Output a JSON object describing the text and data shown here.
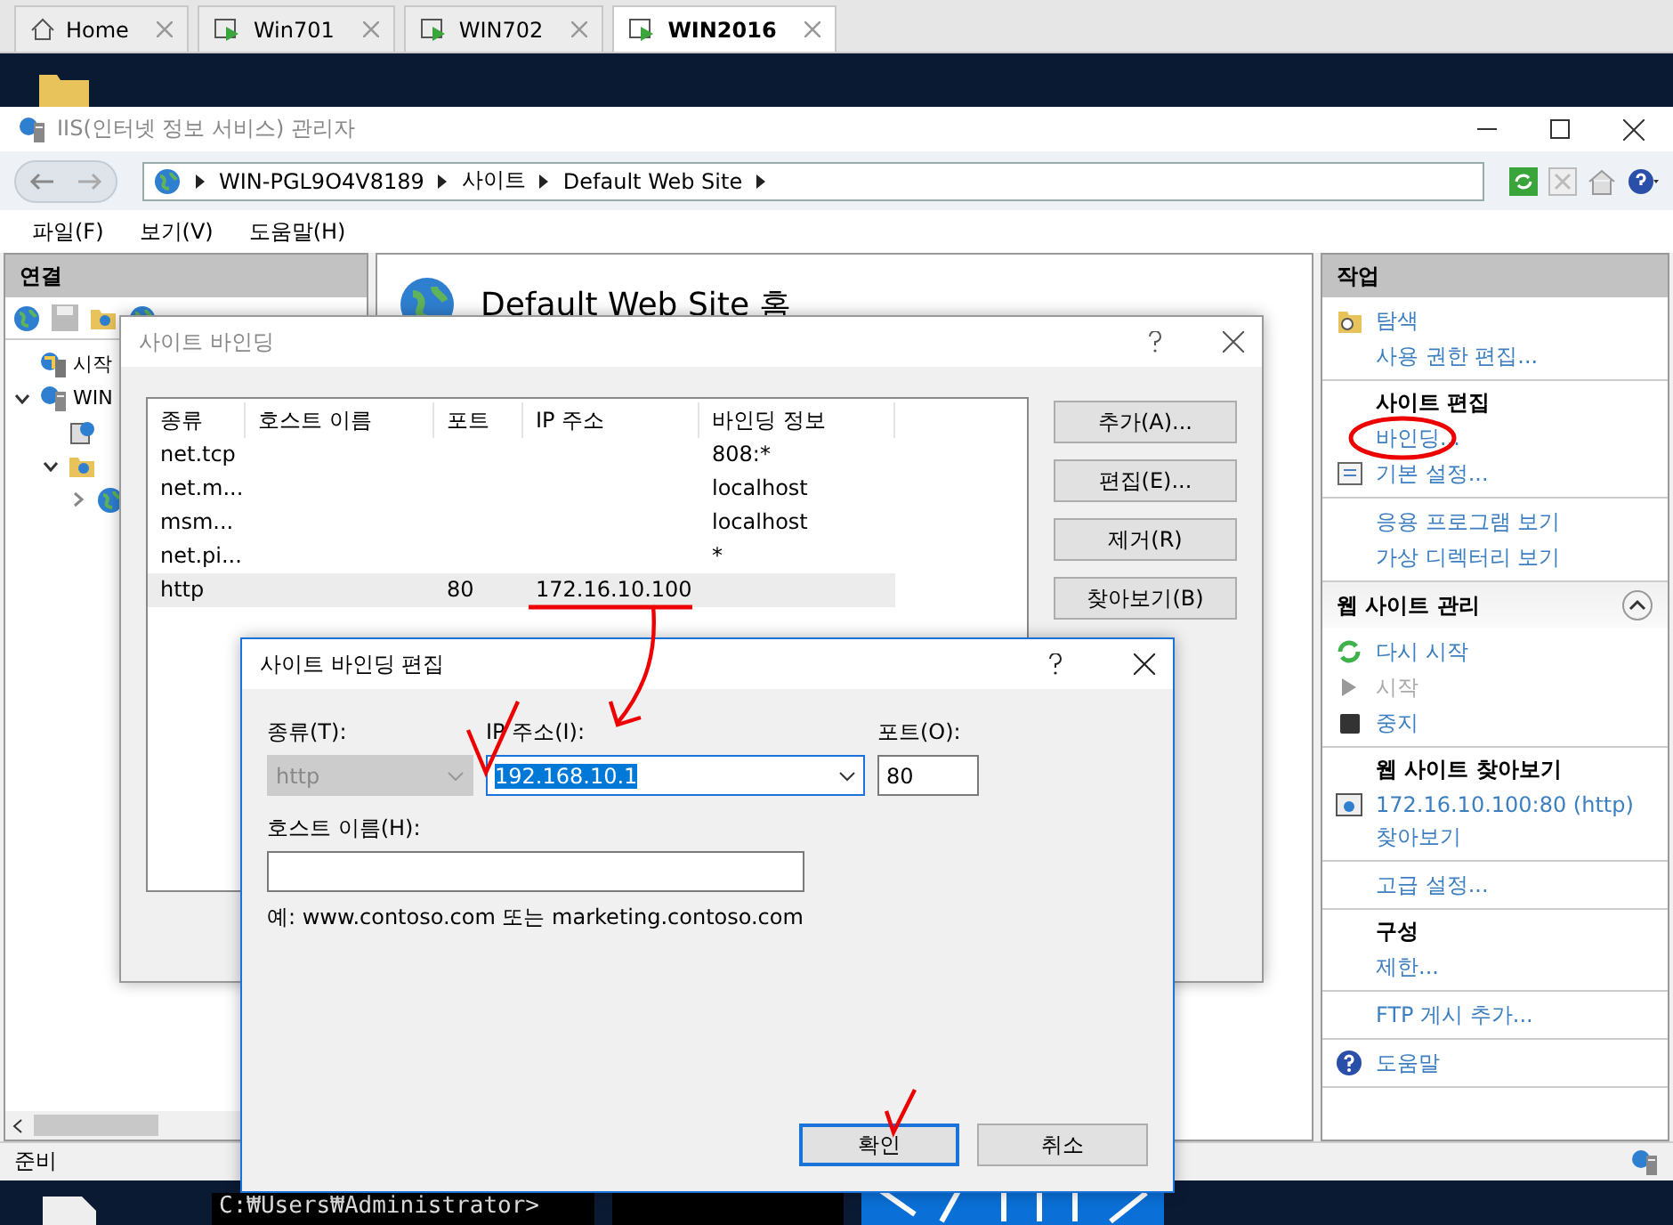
{
  "tabs": [
    {
      "label": "Home",
      "kind": "home",
      "selected": false
    },
    {
      "label": "Win701",
      "kind": "vm",
      "selected": false
    },
    {
      "label": "WIN702",
      "kind": "vm",
      "selected": false
    },
    {
      "label": "WIN2016",
      "kind": "vm",
      "selected": true
    }
  ],
  "window": {
    "title": "IIS(인터넷 정보 서비스) 관리자"
  },
  "address": {
    "segments": [
      "WIN-PGL9O4V8189",
      "사이트",
      "Default Web Site"
    ]
  },
  "menu": [
    "파일(F)",
    "보기(V)",
    "도움말(H)"
  ],
  "connections": {
    "title": "연결",
    "tree": [
      {
        "text": "시작",
        "kind": "start"
      },
      {
        "text": "WIN",
        "kind": "server",
        "expanded": true,
        "children": [
          {
            "kind": "pool"
          },
          {
            "kind": "sites",
            "expanded": true,
            "children": [
              {
                "kind": "site",
                "expanded": false
              }
            ]
          }
        ]
      }
    ]
  },
  "center": {
    "heading": "Default Web Site 홈"
  },
  "actions": {
    "title": "작업",
    "groups": [
      {
        "items": [
          {
            "text": "탐색",
            "kind": "explore"
          },
          {
            "text": "사용 권한 편집...",
            "kind": "link"
          }
        ]
      },
      {
        "title": "사이트 편집",
        "items": [
          {
            "text": "바인딩...",
            "kind": "link"
          },
          {
            "text": "기본 설정...",
            "kind": "settings"
          }
        ]
      },
      {
        "items": [
          {
            "text": "응용 프로그램 보기",
            "kind": "link"
          },
          {
            "text": "가상 디렉터리 보기",
            "kind": "link"
          }
        ]
      },
      {
        "section": "웹 사이트 관리",
        "expanded": true
      },
      {
        "items": [
          {
            "text": "다시 시작",
            "kind": "restart"
          },
          {
            "text": "시작",
            "kind": "start",
            "disabled": true
          },
          {
            "text": "중지",
            "kind": "stop"
          }
        ]
      },
      {
        "title": "웹 사이트 찾아보기",
        "items": [
          {
            "text": "172.16.10.100:80 (http) 찾아보기",
            "kind": "browse"
          }
        ]
      },
      {
        "items": [
          {
            "text": "고급 설정...",
            "kind": "link"
          }
        ]
      },
      {
        "title": "구성",
        "items": [
          {
            "text": "제한...",
            "kind": "link"
          }
        ]
      },
      {
        "items": [
          {
            "text": "FTP 게시 추가...",
            "kind": "link"
          }
        ]
      },
      {
        "items": [
          {
            "text": "도움말",
            "kind": "help"
          }
        ]
      }
    ]
  },
  "status_bar": "준비",
  "bindings_dialog": {
    "title": "사이트 바인딩",
    "columns": [
      "종류",
      "호스트 이름",
      "포트",
      "IP 주소",
      "바인딩 정보"
    ],
    "rows": [
      {
        "cells": [
          "net.tcp",
          "",
          "",
          "",
          "808:*"
        ],
        "selected": false
      },
      {
        "cells": [
          "net.m...",
          "",
          "",
          "",
          "localhost"
        ],
        "selected": false
      },
      {
        "cells": [
          "msm...",
          "",
          "",
          "",
          "localhost"
        ],
        "selected": false
      },
      {
        "cells": [
          "net.pi...",
          "",
          "",
          "",
          "*"
        ],
        "selected": false
      },
      {
        "cells": [
          "http",
          "",
          "80",
          "172.16.10.100",
          ""
        ],
        "selected": true
      }
    ],
    "buttons": [
      "추가(A)...",
      "편집(E)...",
      "제거(R)",
      "찾아보기(B)"
    ]
  },
  "edit_dialog": {
    "title": "사이트 바인딩 편집",
    "type": {
      "label": "종류(T):",
      "value": "http",
      "disabled": true
    },
    "ip": {
      "label": "IP 주소(I):",
      "value": "192.168.10.1"
    },
    "port": {
      "label": "포트(O):",
      "value": "80"
    },
    "host": {
      "label": "호스트 이름(H):"
    },
    "hint": "예: www.contoso.com 또는 marketing.contoso.com",
    "ok": "확인",
    "cancel": "취소"
  },
  "console": {
    "prompt": "C:₩Users₩Administrator>"
  }
}
